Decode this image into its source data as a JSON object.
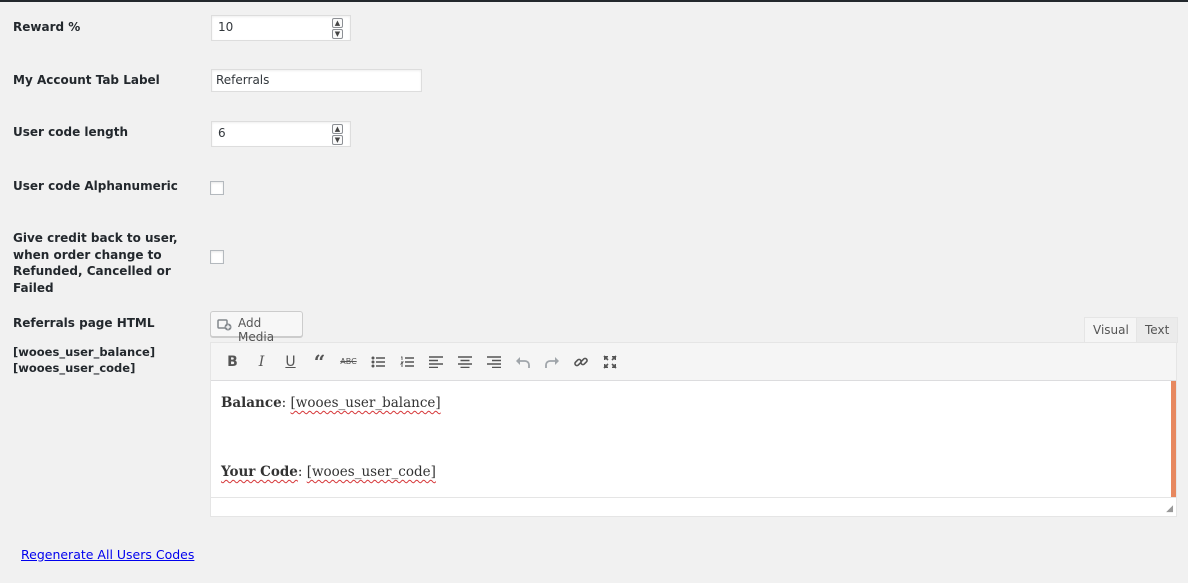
{
  "fields": {
    "reward": {
      "label": "Reward %",
      "value": "10"
    },
    "tab_label": {
      "label": "My Account Tab Label",
      "value": "Referrals"
    },
    "code_length": {
      "label": "User code length",
      "value": "6"
    },
    "alphanumeric": {
      "label": "User code Alphanumeric",
      "checked": false
    },
    "give_credit": {
      "label": "Give credit back to user, when order change to Refunded, Cancelled or Failed",
      "checked": false
    },
    "referrals_html": {
      "label": "Referrals page HTML",
      "shortcodes": [
        "[wooes_user_balance]",
        "[wooes_user_code]"
      ]
    }
  },
  "editor": {
    "add_media_label": "Add Media",
    "tabs": [
      {
        "label": "Visual",
        "active": true
      },
      {
        "label": "Text",
        "active": false
      }
    ],
    "toolbar": [
      "bold-icon",
      "italic-icon",
      "underline-icon",
      "blockquote-icon",
      "strikethrough-icon",
      "bullet-list-icon",
      "numbered-list-icon",
      "align-left-icon",
      "align-center-icon",
      "align-right-icon",
      "undo-icon",
      "redo-icon",
      "link-icon",
      "fullscreen-icon"
    ],
    "content": {
      "line1_bold": "Balance",
      "line1_rest": ": ",
      "line1_code": "[wooes_user_balance]",
      "line2_bold": "Your Code",
      "line2_rest": ": ",
      "line2_code": "[wooes_user_code]"
    }
  },
  "footer": {
    "regenerate_link": "Regenerate All Users Codes"
  },
  "colors": {
    "accent_scroll": "#e7885f",
    "link": "#0000ee"
  }
}
